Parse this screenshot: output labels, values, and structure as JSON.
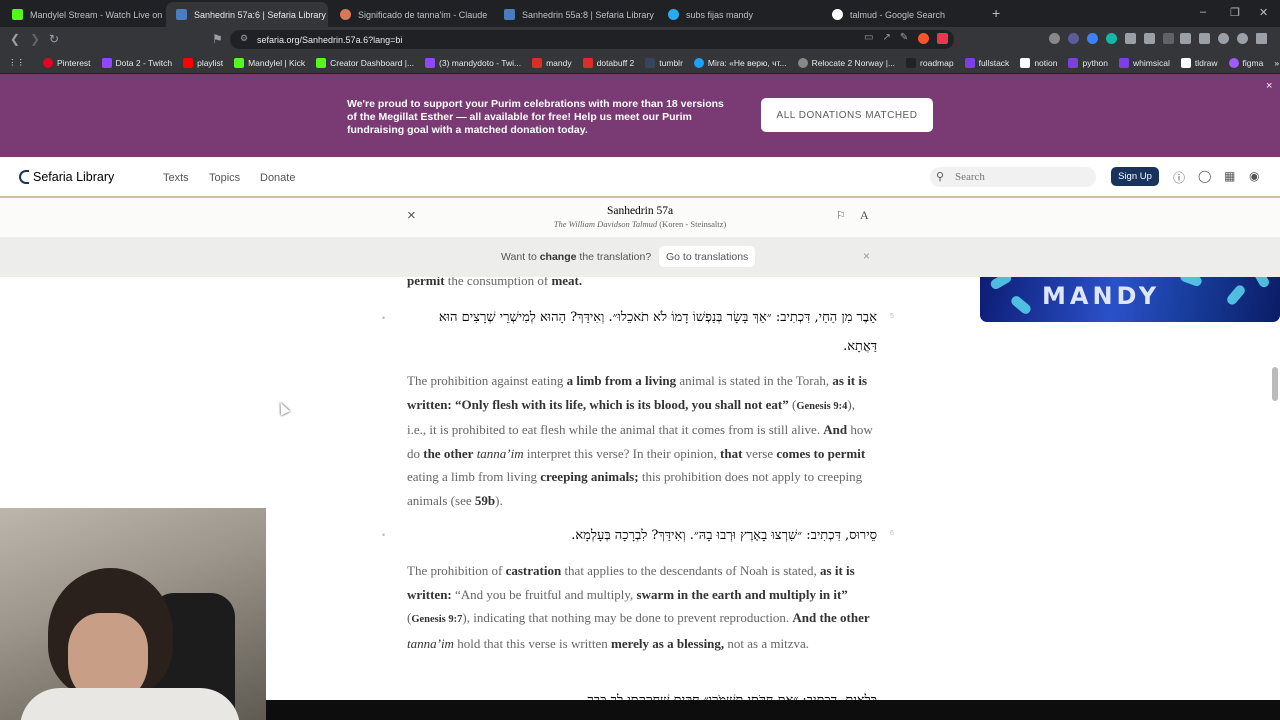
{
  "browser": {
    "tabs": [
      {
        "title": "Mandylel Stream - Watch Live on Kick",
        "color": "#53fc18"
      },
      {
        "title": "Sanhedrin 57a:6 | Sefaria Library",
        "color": "#4a7dbd",
        "active": true
      },
      {
        "title": "Significado de tanna'im - Claude",
        "color": "#d97757"
      },
      {
        "title": "Sanhedrin 55a:8 | Sefaria Library",
        "color": "#4a7dbd"
      },
      {
        "title": "subs fijas mandy",
        "color": "#2aabee"
      },
      {
        "title": "talmud - Google Search",
        "color": "#ffffff"
      }
    ],
    "tab_close": "×",
    "new_tab": "+",
    "window_controls": [
      "–",
      "❐",
      "✕"
    ],
    "url": "sefaria.org/Sanhedrin.57a.6?lang=bi",
    "bookmarks": [
      {
        "label": "Pinterest",
        "color": "#e60023"
      },
      {
        "label": "Dota 2 - Twitch",
        "color": "#9146ff"
      },
      {
        "label": "playlist",
        "color": "#ff0000"
      },
      {
        "label": "Mandylel | Kick",
        "color": "#53fc18"
      },
      {
        "label": "Creator Dashboard |...",
        "color": "#53fc18"
      },
      {
        "label": "(3) mandydoto - Twi...",
        "color": "#9146ff"
      },
      {
        "label": "mandy",
        "color": "#d93025"
      },
      {
        "label": "dotabuff 2",
        "color": "#d93025"
      },
      {
        "label": "tumblr",
        "color": "#36465d"
      },
      {
        "label": "Mira: «Не верю, чт...",
        "color": "#1da1f2"
      },
      {
        "label": "Relocate 2 Norway |...",
        "color": "#888888"
      },
      {
        "label": "roadmap",
        "color": "#222222"
      },
      {
        "label": "fullstack",
        "color": "#7b3fe4"
      },
      {
        "label": "notion",
        "color": "#ffffff"
      },
      {
        "label": "python",
        "color": "#7b3fe4"
      },
      {
        "label": "whimsical",
        "color": "#7b3fe4"
      },
      {
        "label": "tldraw",
        "color": "#ffffff"
      },
      {
        "label": "figma",
        "color": "#a259ff"
      }
    ]
  },
  "banner": {
    "text": "We're proud to support your Purim celebrations with more than 18 versions of the Megillat Esther — all available for free! Help us meet our Purim fundraising goal with a matched donation today.",
    "button": "ALL DONATIONS MATCHED",
    "close": "×",
    "color": "#7a3b74"
  },
  "header": {
    "logo": "Sefaria Library",
    "nav": [
      "Texts",
      "Topics",
      "Donate"
    ],
    "search_placeholder": "Search",
    "signup": "Sign Up"
  },
  "reader": {
    "title": "Sanhedrin 57a",
    "version_italic": "The William Davidson Talmud",
    "version_rest": " (Koren - Steinsaltz)",
    "font_button": "A",
    "close": "×"
  },
  "translation_bar": {
    "prefix": "Want to ",
    "bold": "change",
    "suffix": " the translation?",
    "button": "Go to translations",
    "close": "×"
  },
  "content": {
    "top_fragment_b1": "permit",
    "top_fragment_t1": " the consumption of ",
    "top_fragment_b2": "meat.",
    "seg5_num": "5",
    "seg5_hebrew": "אֵבֶר מִן הַחַי, דִּכְתִיב: ״אַךְ בָּשָׂר בְּנַפְשׁוֹ דָמוֹ לֹא תֹאכֵלוּ״. וְאִידַּךְ? הָהוּא לְמִישְׁרֵי שְׁרָצִים הוּא דַּאֲתָא.",
    "seg5_en": [
      {
        "t": "The prohibition against eating "
      },
      {
        "b": "a limb from a living"
      },
      {
        "t": " animal is stated in the Torah, "
      },
      {
        "b": "as it is written: “Only flesh with its life, which is its blood, you shall not eat”"
      },
      {
        "t": " ("
      },
      {
        "r": "Genesis 9:4"
      },
      {
        "t": "), i.e., it is prohibited to eat flesh while the animal that it comes from is still alive. "
      },
      {
        "b": "And"
      },
      {
        "t": " how do "
      },
      {
        "b": "the other"
      },
      {
        "t": " "
      },
      {
        "i": "tanna’im"
      },
      {
        "t": " interpret this verse? In their opinion, "
      },
      {
        "b": "that"
      },
      {
        "t": " verse "
      },
      {
        "b": "comes to permit"
      },
      {
        "t": " eating a limb from living "
      },
      {
        "b": "creeping animals;"
      },
      {
        "t": " this prohibition does not apply to creeping animals (see "
      },
      {
        "b": "59b"
      },
      {
        "t": ")."
      }
    ],
    "seg6_num": "6",
    "seg6_hebrew": "סֵירוּס, דִּכְתִיב: ״שִׁרְצוּ בָאָרֶץ וּרְבוּ בָהּ״. וְאִידַּךְ? לִבְרָכָה בְּעָלְמָא.",
    "seg6_en": [
      {
        "t": "The prohibition of "
      },
      {
        "b": "castration"
      },
      {
        "t": " that applies to the descendants of Noah is stated, "
      },
      {
        "b": "as it is written:"
      },
      {
        "t": " “And you be fruitful and multiply, "
      },
      {
        "b": "swarm in the earth and multiply in it”"
      },
      {
        "t": " ("
      },
      {
        "r": "Genesis 9:7"
      },
      {
        "t": "), indicating that nothing may be done to prevent reproduction. "
      },
      {
        "b": "And the other"
      },
      {
        "t": " "
      },
      {
        "i": "tanna’im"
      },
      {
        "t": " hold that this verse is written "
      },
      {
        "b": "merely as a blessing,"
      },
      {
        "t": " not as a mitzva."
      }
    ],
    "seg7_hebrew_partial": "כִּלְאַיִם, דִּכְתִיב: ״אֶת חֻקֹּתַי תִּשְׁמֹרוּ״ חֻקִּים שֶׁחָקַקְתִּי לְךָ כְּבָר."
  },
  "overlay": {
    "stream_logo": "MANDY"
  }
}
